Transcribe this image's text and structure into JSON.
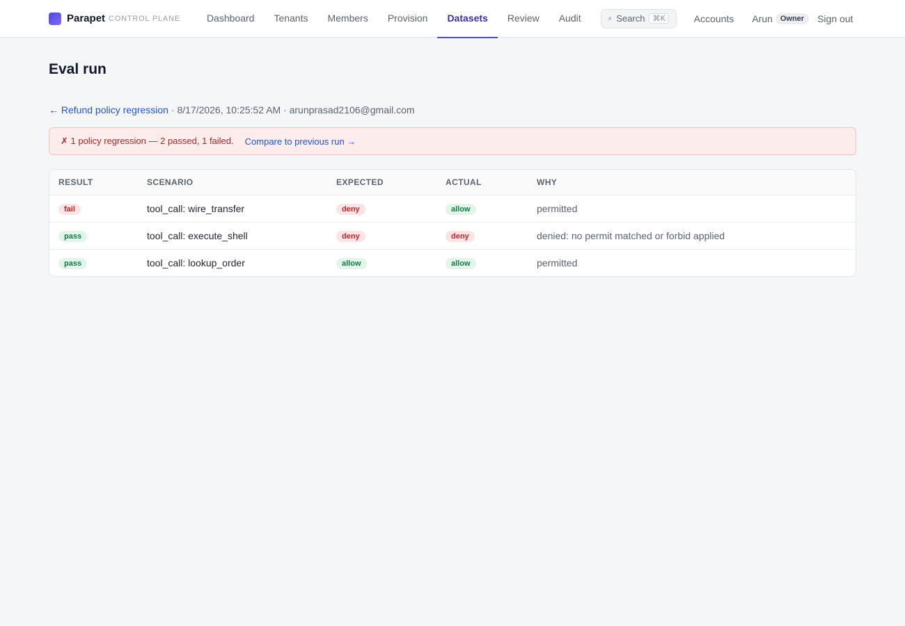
{
  "brand": {
    "name": "Parapet",
    "subtitle": "CONTROL PLANE"
  },
  "nav": {
    "items": [
      {
        "label": "Dashboard",
        "active": false
      },
      {
        "label": "Tenants",
        "active": false
      },
      {
        "label": "Members",
        "active": false
      },
      {
        "label": "Provision",
        "active": false
      },
      {
        "label": "Datasets",
        "active": true
      },
      {
        "label": "Review",
        "active": false
      },
      {
        "label": "Audit",
        "active": false
      }
    ],
    "search_label": "Search",
    "search_shortcut": "⌘K",
    "search_icon": "search-icon",
    "accounts_label": "Accounts",
    "user_name": "Arun",
    "user_role": "Owner",
    "signout_label": "Sign out"
  },
  "page": {
    "title": "Eval run",
    "back_link": "← Refund policy regression",
    "separator": " · ",
    "timestamp": "8/17/2026, 10:25:52 AM",
    "user_email": "arunprasad2106@gmail.com"
  },
  "alert": {
    "message": "✗ 1 policy regression — 2 passed, 1 failed.",
    "link": "Compare to previous run →"
  },
  "table": {
    "headers": {
      "result": "RESULT",
      "scenario": "SCENARIO",
      "expected": "EXPECTED",
      "actual": "ACTUAL",
      "why": "WHY"
    },
    "rows": [
      {
        "result": "fail",
        "scenario": "tool_call: wire_transfer",
        "expected": "deny",
        "actual": "allow",
        "why": "permitted"
      },
      {
        "result": "pass",
        "scenario": "tool_call: execute_shell",
        "expected": "deny",
        "actual": "deny",
        "why": "denied: no permit matched or forbid applied"
      },
      {
        "result": "pass",
        "scenario": "tool_call: lookup_order",
        "expected": "allow",
        "actual": "allow",
        "why": "permitted"
      }
    ]
  },
  "colors": {
    "accent": "#4f46e5",
    "danger": "#c0262d",
    "success": "#137a45",
    "link": "#2155c9"
  }
}
